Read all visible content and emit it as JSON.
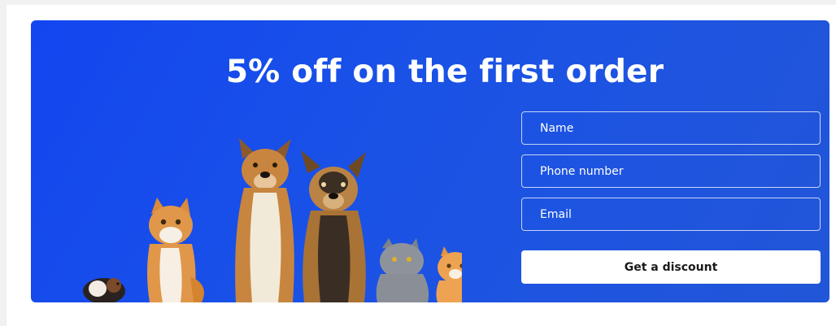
{
  "promo": {
    "title": "5% off on the first order"
  },
  "form": {
    "name_placeholder": "Name",
    "phone_placeholder": "Phone number",
    "email_placeholder": "Email",
    "submit_label": "Get a discount"
  },
  "colors": {
    "banner_blue": "#1a4fe8",
    "button_bg": "#ffffff",
    "text_light": "#ffffff"
  },
  "illustration": {
    "animals": [
      "guinea-pig",
      "ginger-cat",
      "dog",
      "shepherd-dog",
      "gray-kitten",
      "ginger-kitten"
    ]
  }
}
